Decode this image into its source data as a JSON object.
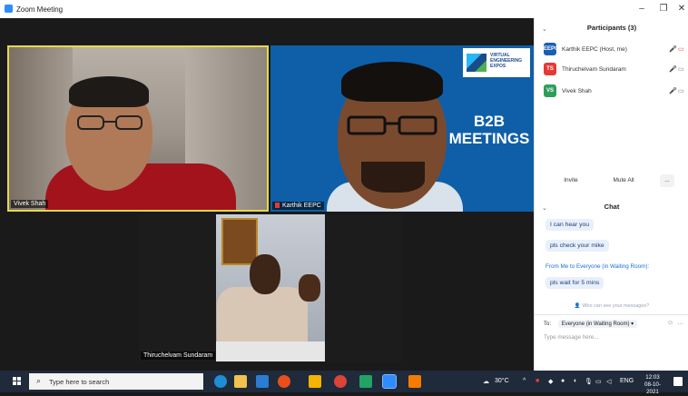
{
  "window": {
    "title": "Zoom Meeting",
    "controls": {
      "minimize": "–",
      "restore": "❐",
      "close": "✕"
    }
  },
  "video": {
    "tiles": [
      {
        "name": "Vivek Shah",
        "active_speaker": true
      },
      {
        "name": "Karthik EEPC",
        "muted": true,
        "background_text": "B2B\nMEETINGS",
        "logo_text": "VIRTUAL\nENGINEERING\nEXPOS"
      },
      {
        "name": "Thiruchelvam Sundaram"
      }
    ]
  },
  "participants": {
    "header": "Participants (3)",
    "list": [
      {
        "initials": "EEPC",
        "name": "Karthik EEPC (Host, me)",
        "color": "#1a5fb4"
      },
      {
        "initials": "TS",
        "name": "Thiruchelvam Sundaram",
        "color": "#e53935"
      },
      {
        "initials": "VS",
        "name": "Vivek Shah",
        "color": "#2e9e5b"
      }
    ],
    "invite_label": "Invite",
    "mute_all_label": "Mute All",
    "more_label": "..."
  },
  "chat": {
    "header": "Chat",
    "messages": [
      "I can hear you",
      "pls check your mike"
    ],
    "system_message": "From Me to Everyone (in Waiting Room):",
    "last_message": "pls wait for 5 mins",
    "who_can_see": "Who can see your messages?",
    "to_label": "To:",
    "to_value": "Everyone (in Waiting Room)",
    "input_placeholder": "Type message here..."
  },
  "taskbar": {
    "search_placeholder": "Type here to search",
    "weather": "30°C",
    "language": "ENG",
    "time": "12:03",
    "date": "08-10-2021"
  }
}
